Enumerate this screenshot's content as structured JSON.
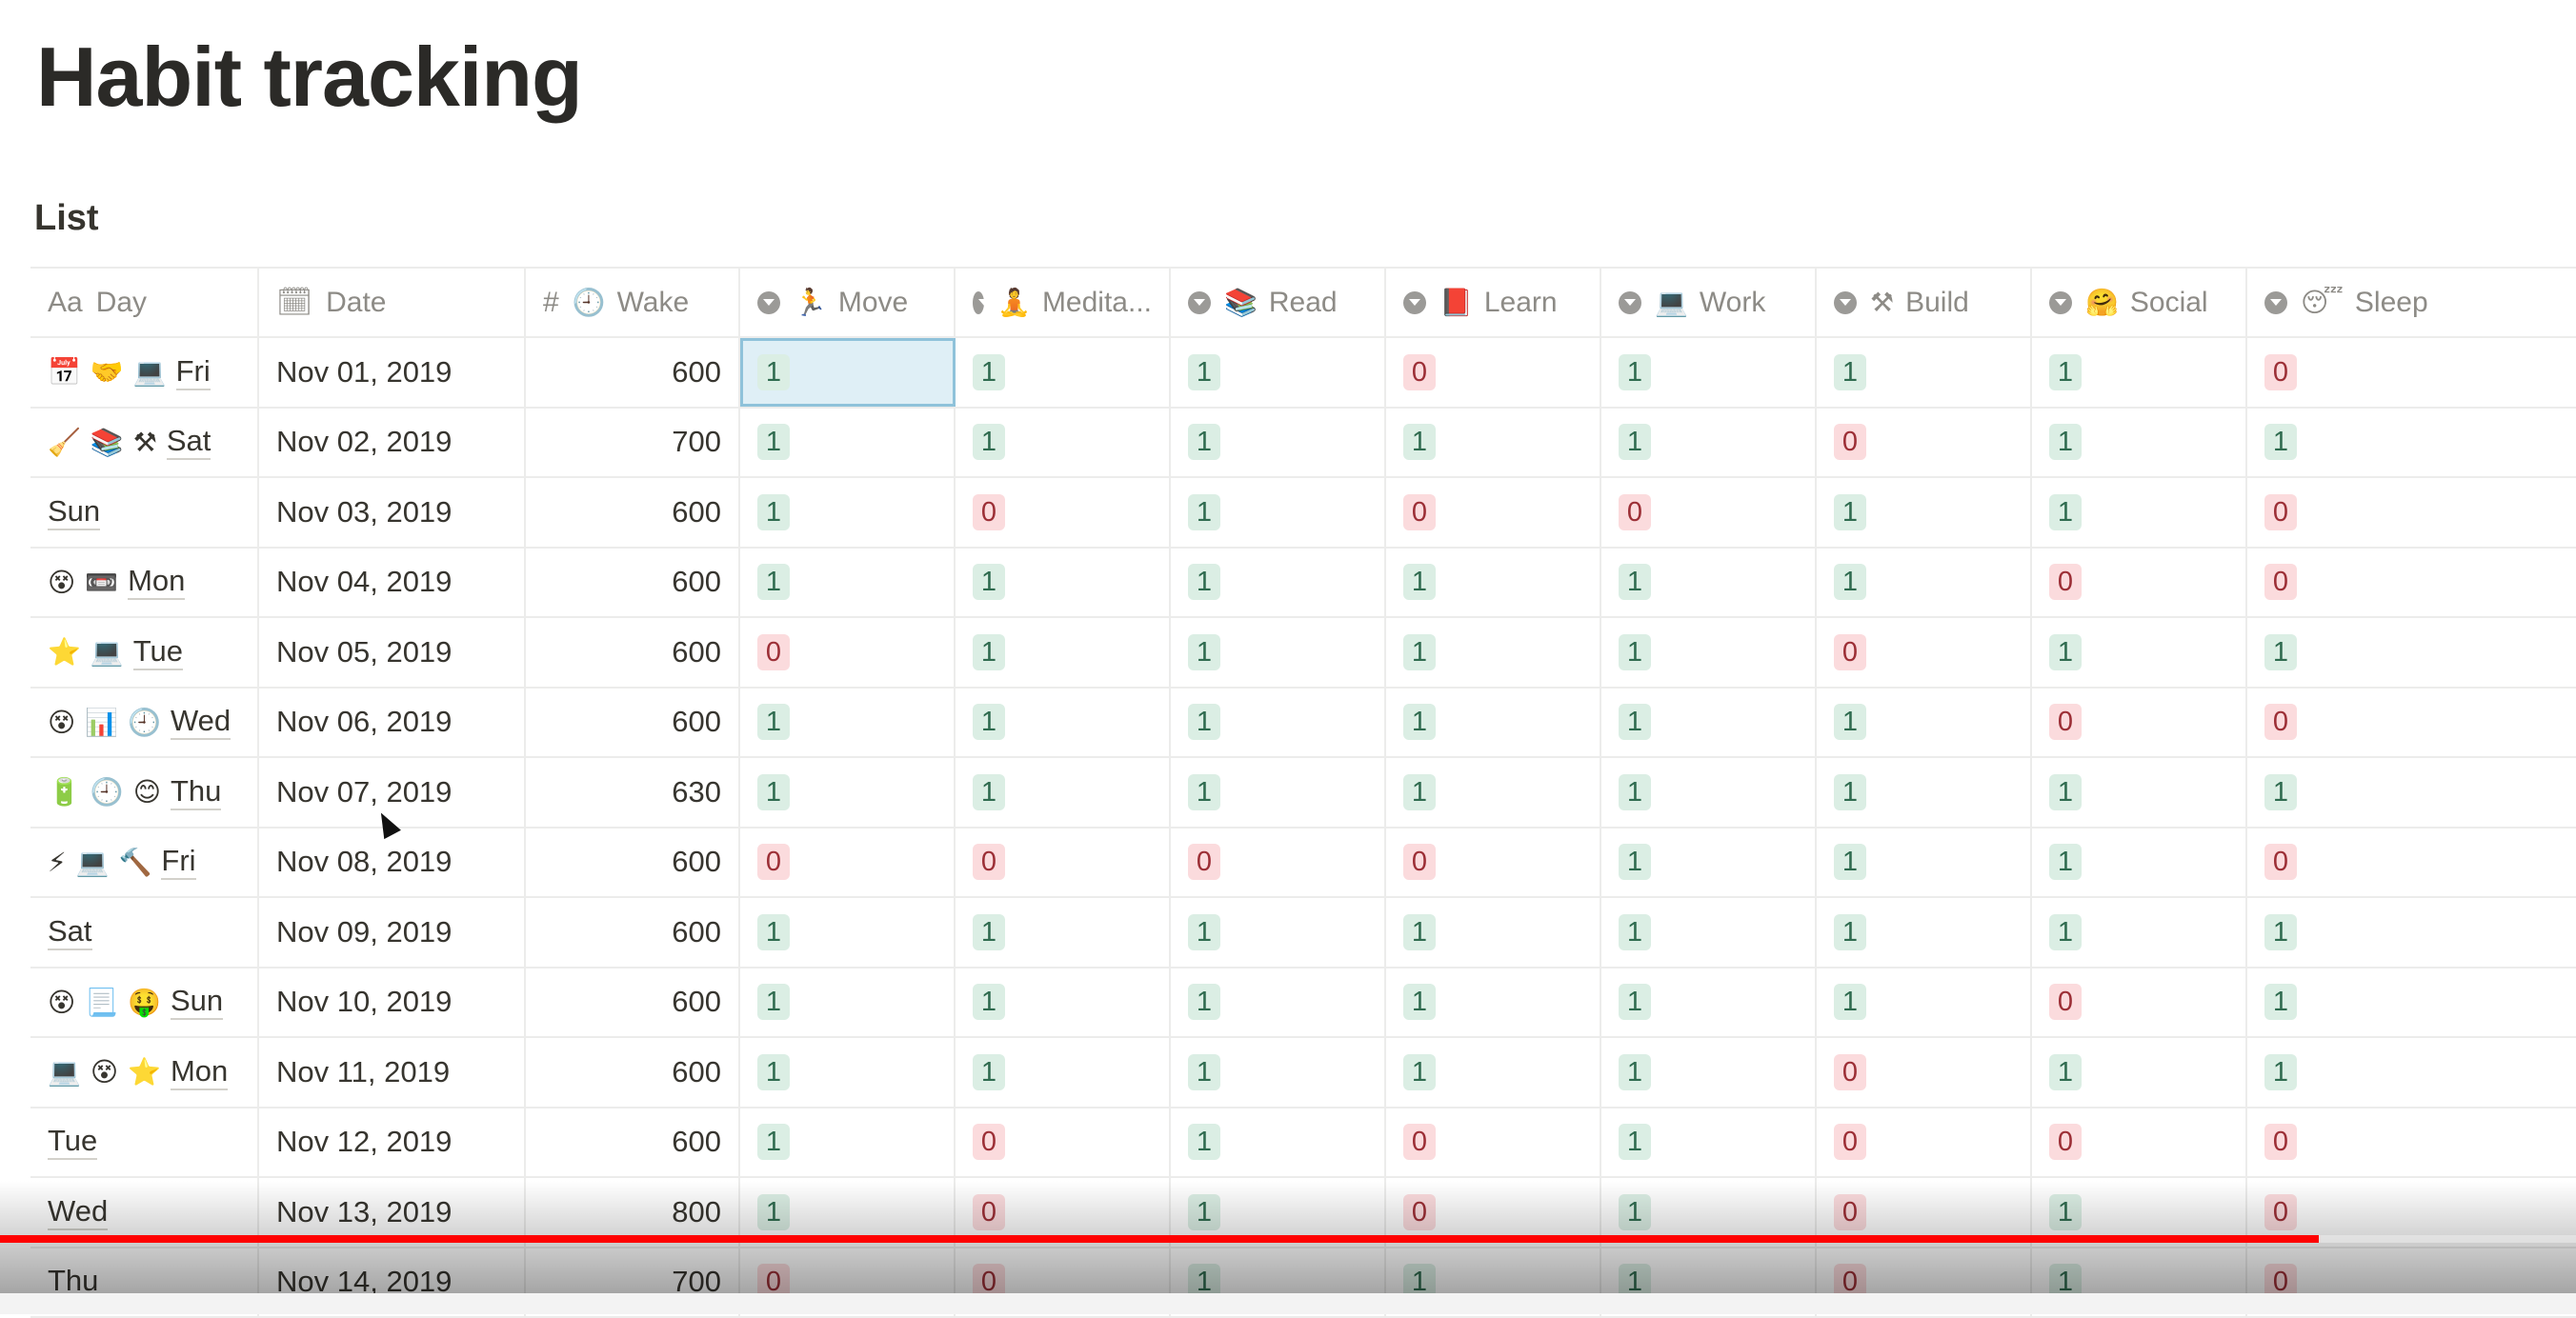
{
  "page": {
    "title": "Habit tracking",
    "view_title": "List"
  },
  "columns": [
    {
      "key": "day",
      "label": "Day",
      "icon": "text-property-icon",
      "glyph": "Aa"
    },
    {
      "key": "date",
      "label": "Date",
      "icon": "calendar-property-icon",
      "glyph": "🗓"
    },
    {
      "key": "wake",
      "label": "Wake",
      "icon": "number-property-icon",
      "glyph": "#",
      "emoji": "🕘"
    },
    {
      "key": "move",
      "label": "Move",
      "icon": "select-property-icon",
      "emoji": "🏃"
    },
    {
      "key": "meditate",
      "label": "Medita...",
      "icon": "select-property-icon",
      "emoji": "🧘"
    },
    {
      "key": "read",
      "label": "Read",
      "icon": "select-property-icon",
      "emoji": "📚"
    },
    {
      "key": "learn",
      "label": "Learn",
      "icon": "select-property-icon",
      "emoji": "📕"
    },
    {
      "key": "work",
      "label": "Work",
      "icon": "select-property-icon",
      "emoji": "💻"
    },
    {
      "key": "build",
      "label": "Build",
      "icon": "select-property-icon",
      "emoji": "⚒"
    },
    {
      "key": "social",
      "label": "Social",
      "icon": "select-property-icon",
      "emoji": "🤗"
    },
    {
      "key": "sleep",
      "label": "Sleep",
      "icon": "select-property-icon",
      "emoji": "😴"
    }
  ],
  "rows": [
    {
      "emoji": [
        "📅",
        "🤝",
        "💻"
      ],
      "day": "Fri",
      "date": "Nov 01, 2019",
      "wake": "600",
      "habits": [
        "1",
        "1",
        "1",
        "0",
        "1",
        "1",
        "1",
        "0"
      ]
    },
    {
      "emoji": [
        "🧹",
        "📚",
        "⚒"
      ],
      "day": "Sat",
      "date": "Nov 02, 2019",
      "wake": "700",
      "habits": [
        "1",
        "1",
        "1",
        "1",
        "1",
        "0",
        "1",
        "1"
      ]
    },
    {
      "emoji": [],
      "day": "Sun",
      "date": "Nov 03, 2019",
      "wake": "600",
      "habits": [
        "1",
        "0",
        "1",
        "0",
        "0",
        "1",
        "1",
        "0"
      ]
    },
    {
      "emoji": [
        "😵",
        "📼"
      ],
      "day": "Mon",
      "date": "Nov 04, 2019",
      "wake": "600",
      "habits": [
        "1",
        "1",
        "1",
        "1",
        "1",
        "1",
        "0",
        "0"
      ]
    },
    {
      "emoji": [
        "⭐",
        "💻"
      ],
      "day": "Tue",
      "date": "Nov 05, 2019",
      "wake": "600",
      "habits": [
        "0",
        "1",
        "1",
        "1",
        "1",
        "0",
        "1",
        "1"
      ]
    },
    {
      "emoji": [
        "😵",
        "📊",
        "🕘"
      ],
      "day": "Wed",
      "date": "Nov 06, 2019",
      "wake": "600",
      "habits": [
        "1",
        "1",
        "1",
        "1",
        "1",
        "1",
        "0",
        "0"
      ]
    },
    {
      "emoji": [
        "🔋",
        "🕘",
        "😊"
      ],
      "day": "Thu",
      "date": "Nov 07, 2019",
      "wake": "630",
      "habits": [
        "1",
        "1",
        "1",
        "1",
        "1",
        "1",
        "1",
        "1"
      ]
    },
    {
      "emoji": [
        "⚡",
        "💻",
        "🔨"
      ],
      "day": "Fri",
      "date": "Nov 08, 2019",
      "wake": "600",
      "habits": [
        "0",
        "0",
        "0",
        "0",
        "1",
        "1",
        "1",
        "0"
      ]
    },
    {
      "emoji": [],
      "day": "Sat",
      "date": "Nov 09, 2019",
      "wake": "600",
      "habits": [
        "1",
        "1",
        "1",
        "1",
        "1",
        "1",
        "1",
        "1"
      ]
    },
    {
      "emoji": [
        "😵",
        "📃",
        "🤑"
      ],
      "day": "Sun",
      "date": "Nov 10, 2019",
      "wake": "600",
      "habits": [
        "1",
        "1",
        "1",
        "1",
        "1",
        "1",
        "0",
        "1"
      ]
    },
    {
      "emoji": [
        "💻",
        "😵",
        "⭐"
      ],
      "day": "Mon",
      "date": "Nov 11, 2019",
      "wake": "600",
      "habits": [
        "1",
        "1",
        "1",
        "1",
        "1",
        "0",
        "1",
        "1"
      ]
    },
    {
      "emoji": [],
      "day": "Tue",
      "date": "Nov 12, 2019",
      "wake": "600",
      "habits": [
        "1",
        "0",
        "1",
        "0",
        "1",
        "0",
        "0",
        "0"
      ]
    },
    {
      "emoji": [],
      "day": "Wed",
      "date": "Nov 13, 2019",
      "wake": "800",
      "habits": [
        "1",
        "0",
        "1",
        "0",
        "1",
        "0",
        "1",
        "0"
      ]
    },
    {
      "emoji": [],
      "day": "Thu",
      "date": "Nov 14, 2019",
      "wake": "700",
      "habits": [
        "0",
        "0",
        "1",
        "1",
        "1",
        "0",
        "1",
        "0"
      ]
    }
  ],
  "selected_cell": {
    "row": 0,
    "column": "move"
  },
  "video": {
    "progress": 0.9
  },
  "colors": {
    "tag_true_bg": "#dbeee4",
    "tag_false_bg": "#fbdbdd",
    "progress": "#ff0000"
  }
}
